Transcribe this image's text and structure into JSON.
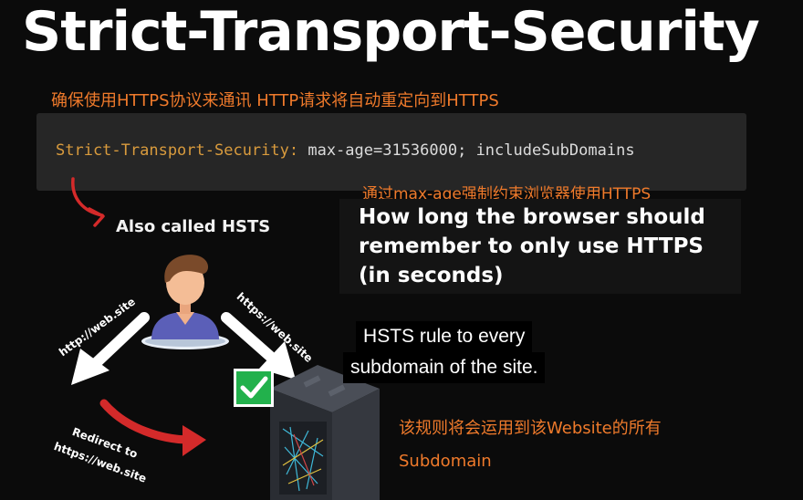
{
  "title": "Strict-Transport-Security",
  "annotations": {
    "top_cn": "确保使用HTTPS协议来通讯   HTTP请求将自动重定向到HTTPS",
    "max_age_cn": "通过max-age强制约束浏览器使用HTTPS",
    "subdomain_cn_line1": "该规则将会运用到该Website的所有",
    "subdomain_cn_line2": "Subdomain"
  },
  "code": {
    "header_name": "Strict-Transport-Security:",
    "header_value": " max-age=31536000; includeSubDomains"
  },
  "hsts_label": "Also called HSTS",
  "max_age_explanation": {
    "line1": "How long the browser should",
    "line2": "remember to only use HTTPS",
    "line3": "(in seconds)"
  },
  "caption": {
    "line1": "HSTS rule to every",
    "line2": "subdomain of the site."
  },
  "diagram": {
    "http_label": "http://web.site",
    "https_label": "https://web.site",
    "redirect_line1": "Redirect to",
    "redirect_line2": "https://web.site"
  },
  "colors": {
    "background": "#0b0b0b",
    "annotation_orange": "#ef7a2b",
    "code_key": "#d99b3d",
    "code_box": "#262626",
    "check_green": "#22b14c",
    "arrow_red": "#d42a2a",
    "user_shirt": "#5b5fb8",
    "user_hair": "#7a4a2a"
  },
  "icons": [
    "user-avatar-icon",
    "checkmark-icon",
    "server-rack-icon",
    "arrow-icon"
  ]
}
